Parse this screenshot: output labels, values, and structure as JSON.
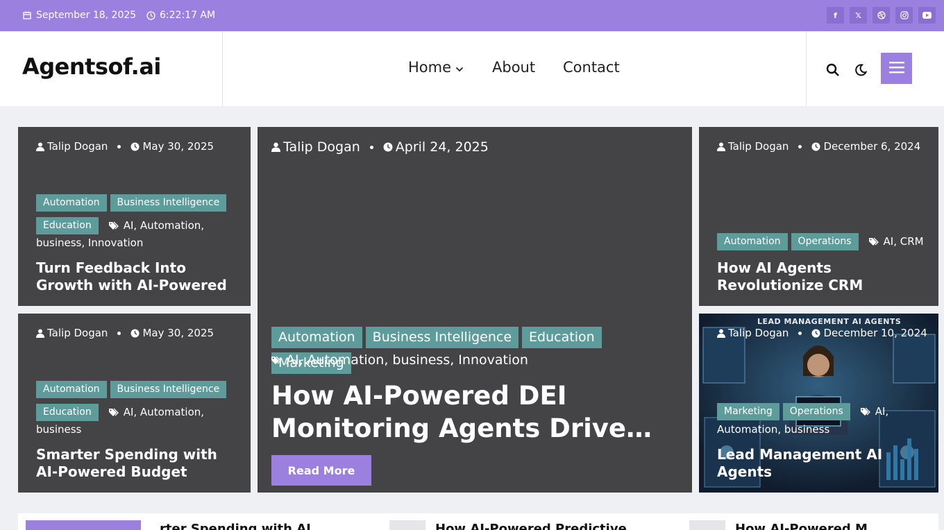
{
  "topbar": {
    "date": "September 18, 2025",
    "time": "6:22:17 AM",
    "socials": [
      "facebook-icon",
      "x-icon",
      "dribbble-icon",
      "instagram-icon",
      "youtube-icon"
    ]
  },
  "header": {
    "logo": "Agentsof.ai",
    "nav": {
      "home": "Home",
      "about": "About",
      "contact": "Contact"
    }
  },
  "colors": {
    "accent": "#9b80e0",
    "category": "#5e9c9c",
    "card": "#444446"
  },
  "cards": {
    "c1": {
      "author": "Talip Dogan",
      "date": "May 30, 2025",
      "categories": [
        "Automation",
        "Business Intelligence",
        "Education"
      ],
      "tags": "AI, Automation,",
      "tags2": "business, Innovation",
      "title": "Turn Feedback Into Growth with AI-Powered Custom…"
    },
    "c2": {
      "author": "Talip Dogan",
      "date": "May 30, 2025",
      "categories": [
        "Automation",
        "Business Intelligence",
        "Education"
      ],
      "tags": "AI, Automation,",
      "tags2": "business",
      "title": "Smarter Spending with AI-Powered Budget Allocatio…"
    },
    "big": {
      "author": "Talip Dogan",
      "date": "April 24, 2025",
      "categories": [
        "Automation",
        "Business Intelligence",
        "Education",
        "Marketing"
      ],
      "tags": "AI, Automation, business, Innovation",
      "title": "How AI-Powered DEI Monitoring Agents Drive…",
      "read_more": "Read More"
    },
    "c3": {
      "author": "Talip Dogan",
      "date": "December 6, 2024",
      "categories": [
        "Automation",
        "Operations"
      ],
      "tags": "AI, CRM",
      "title": "How AI Agents Revolutionize CRM"
    },
    "c4": {
      "author": "Talip Dogan",
      "date": "December 10, 2024",
      "categories": [
        "Marketing",
        "Operations"
      ],
      "tags": "AI,",
      "tags2": "Automation, business",
      "title": "Lead Management AI Agents",
      "image_text": "LEAD MANAGEMENT AI AGENTS"
    }
  },
  "strip": {
    "items": [
      "rter Spending with AI",
      "How AI-Powered Predictive",
      "How AI-Powered M"
    ]
  }
}
